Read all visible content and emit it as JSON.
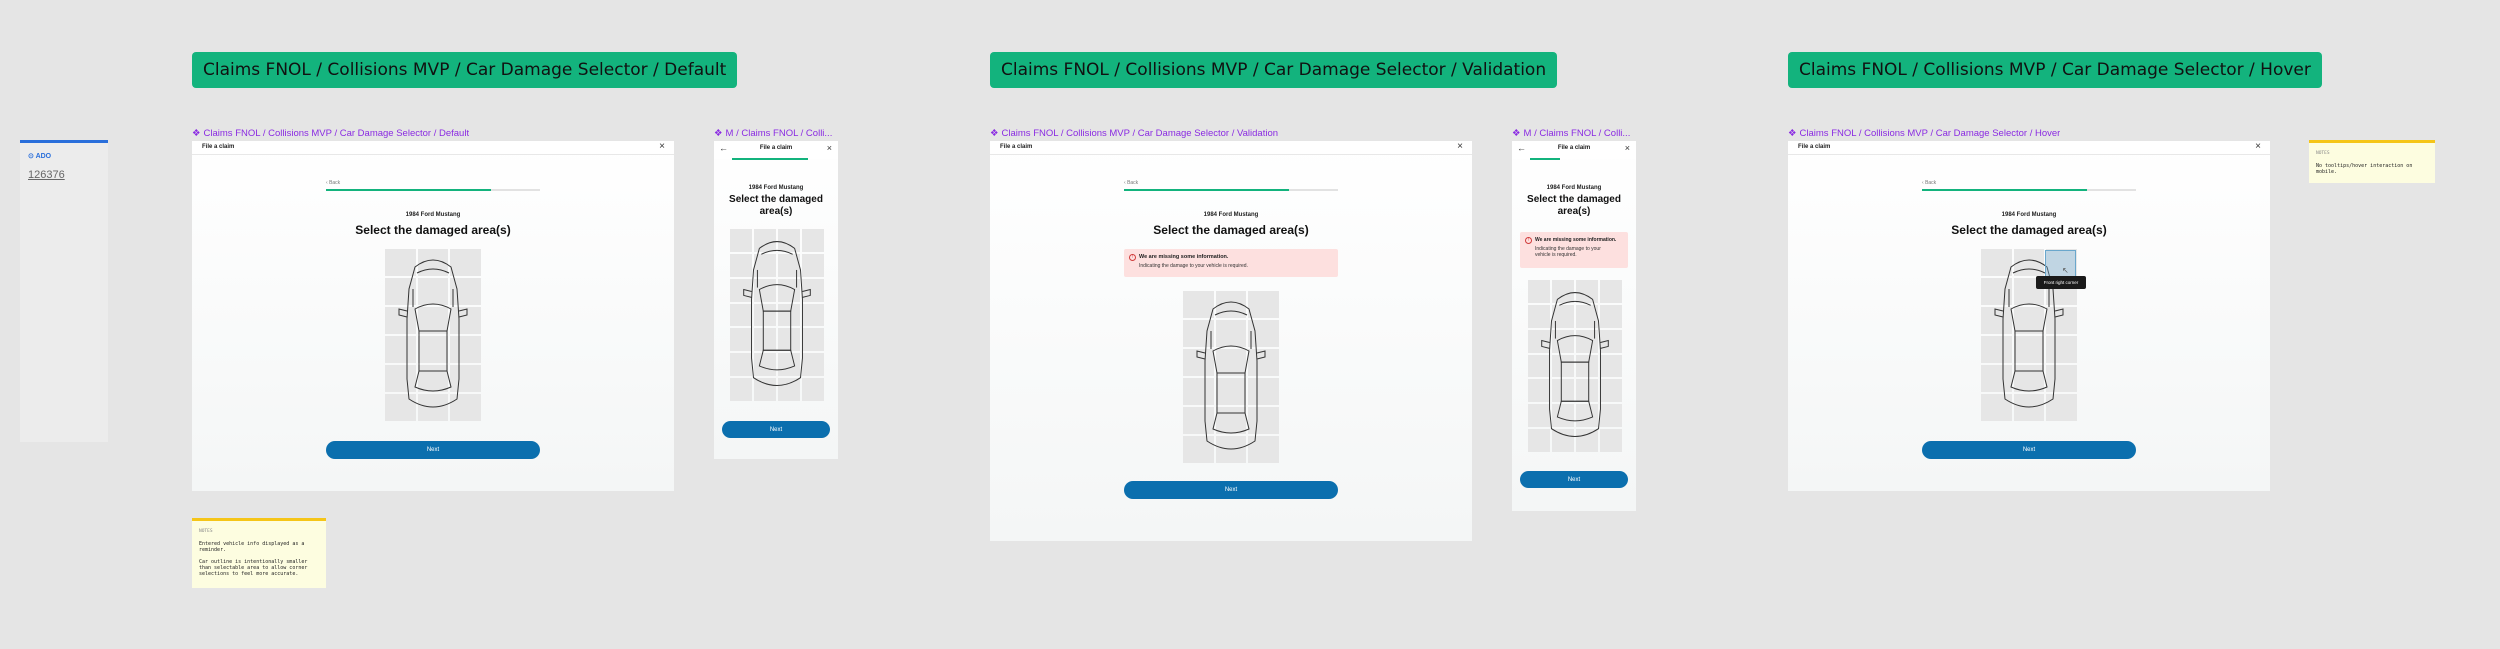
{
  "banners": {
    "default": "Claims FNOL / Collisions MVP / Car Damage Selector / Default",
    "validation": "Claims FNOL / Collisions MVP / Car Damage Selector / Validation",
    "hover": "Claims FNOL / Collisions MVP / Car Damage Selector / Hover"
  },
  "frame_labels": {
    "default": "Claims FNOL / Collisions MVP / Car Damage Selector / Default",
    "default_mobile": "M / Claims FNOL / Colli...",
    "validation": "Claims FNOL / Collisions MVP / Car Damage Selector / Validation",
    "validation_mobile": "M / Claims FNOL / Colli...",
    "hover": "Claims FNOL / Collisions MVP / Car Damage Selector / Hover"
  },
  "ado": {
    "label": "ADO",
    "number": "126376"
  },
  "screen": {
    "title": "File a claim",
    "back": "Back",
    "vehicle": "1984 Ford Mustang",
    "heading": "Select the damaged area(s)",
    "heading_mobile_line1": "Select the damaged",
    "heading_mobile_line2": "area(s)",
    "next": "Next",
    "close": "×",
    "back_arrow": "←"
  },
  "validation_alert": {
    "title": "We are missing some information.",
    "body": "Indicating the damage to your vehicle is required.",
    "body_mobile_1": "Indicating the damage to your",
    "body_mobile_2": "vehicle is required."
  },
  "hover_tooltip": "Front right corner",
  "notes": {
    "left": {
      "tag": "NOTES",
      "body": "Entered vehicle info displayed as a reminder.\n\nCar outline is intentionally smaller than selectable area to allow corner selections to feel more accurate."
    },
    "right": {
      "tag": "NOTES",
      "body": "No tooltips/hover interaction on mobile."
    }
  },
  "colors": {
    "accent_green": "#13b37d",
    "primary_blue": "#0b6fae",
    "error_bg": "#fde0df",
    "label_purple": "#8a2be2"
  }
}
